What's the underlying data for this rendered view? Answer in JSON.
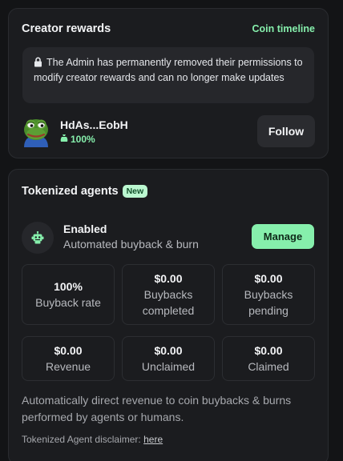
{
  "creator_rewards": {
    "title": "Creator rewards",
    "timeline_link": "Coin timeline",
    "notice": "The Admin has permanently removed their permissions to modify creator rewards and can no longer make updates",
    "creator": {
      "name": "HdAs...EobH",
      "share": "100%"
    },
    "follow_label": "Follow"
  },
  "tokenized_agents": {
    "title": "Tokenized agents",
    "badge": "New",
    "status": "Enabled",
    "description": "Automated buyback & burn",
    "manage_label": "Manage",
    "stats": [
      {
        "value": "100%",
        "label": "Buyback rate"
      },
      {
        "value": "$0.00",
        "label": "Buybacks completed"
      },
      {
        "value": "$0.00",
        "label": "Buybacks pending"
      },
      {
        "value": "$0.00",
        "label": "Revenue"
      },
      {
        "value": "$0.00",
        "label": "Unclaimed"
      },
      {
        "value": "$0.00",
        "label": "Claimed"
      }
    ],
    "info_text": "Automatically direct revenue to coin buybacks & burns performed by agents or humans.",
    "disclaimer_prefix": "Tokenized Agent disclaimer: ",
    "disclaimer_link": "here"
  },
  "colors": {
    "background": "#131416",
    "card": "#1b1c1f",
    "accent_green": "#86efac"
  },
  "icons": [
    "lock-icon",
    "frog-avatar",
    "bag-icon",
    "robot-icon"
  ]
}
